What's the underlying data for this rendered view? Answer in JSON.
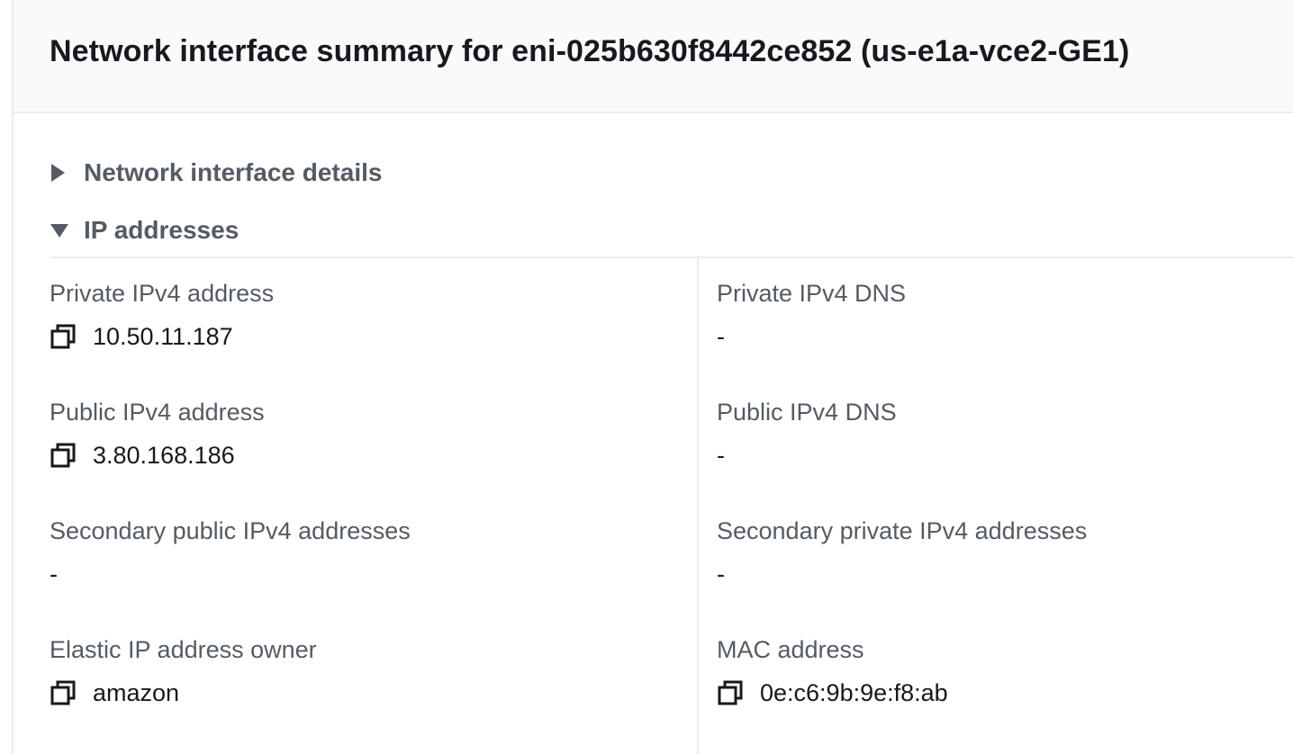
{
  "summary": {
    "title": "Network interface summary for eni-025b630f8442ce852 (us-e1a-vce2-GE1)"
  },
  "sections": {
    "details_label": "Network interface details",
    "details_expanded": false,
    "ip_label": "IP addresses",
    "ip_expanded": true
  },
  "ip_addresses": {
    "private_ipv4_address": {
      "label": "Private IPv4 address",
      "value": "10.50.11.187"
    },
    "private_ipv4_dns": {
      "label": "Private IPv4 DNS",
      "value": "-"
    },
    "public_ipv4_address": {
      "label": "Public IPv4 address",
      "value": "3.80.168.186"
    },
    "public_ipv4_dns": {
      "label": "Public IPv4 DNS",
      "value": "-"
    },
    "secondary_public_ipv4": {
      "label": "Secondary public IPv4 addresses",
      "value": "-"
    },
    "secondary_private_ipv4": {
      "label": "Secondary private IPv4 addresses",
      "value": "-"
    },
    "elastic_ip_owner": {
      "label": "Elastic IP address owner",
      "value": "amazon"
    },
    "mac_address": {
      "label": "MAC address",
      "value": "0e:c6:9b:9e:f8:ab"
    }
  },
  "icons": {
    "copy": "copy-icon",
    "collapsed": "caret-right-icon",
    "expanded": "caret-down-icon"
  },
  "colors": {
    "text_primary": "#16191f",
    "text_secondary": "#545b64",
    "header_bg": "#fafafa",
    "divider": "#eaeded"
  }
}
